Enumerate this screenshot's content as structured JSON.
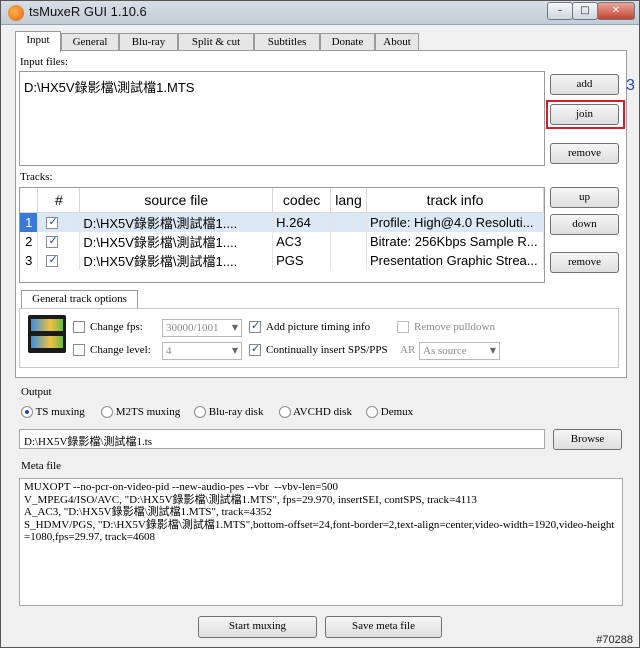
{
  "window": {
    "title": "tsMuxeR GUI 1.10.6",
    "controls": {
      "minimize": "–",
      "maximize": "□",
      "close": "✕"
    }
  },
  "tabs": [
    {
      "label": "Input",
      "active": true
    },
    {
      "label": "General"
    },
    {
      "label": "Blu-ray"
    },
    {
      "label": "Split & cut"
    },
    {
      "label": "Subtitles"
    },
    {
      "label": "Donate"
    },
    {
      "label": "About"
    }
  ],
  "input": {
    "label": "Input files:",
    "files": [
      "D:\\HX5V錄影檔\\測試檔1.MTS"
    ],
    "buttons": {
      "add": "add",
      "join": "join",
      "remove": "remove"
    }
  },
  "stray_text": "3",
  "tracks": {
    "label": "Tracks:",
    "columns": [
      "#",
      "source file",
      "codec",
      "lang",
      "track info"
    ],
    "rows": [
      {
        "num": "1",
        "source": "D:\\HX5V錄影檔\\測試檔1....",
        "codec": "H.264",
        "lang": "",
        "info": "Profile: High@4.0  Resoluti..."
      },
      {
        "num": "2",
        "source": "D:\\HX5V錄影檔\\測試檔1....",
        "codec": "AC3",
        "lang": "",
        "info": "Bitrate: 256Kbps Sample R..."
      },
      {
        "num": "3",
        "source": "D:\\HX5V錄影檔\\測試檔1....",
        "codec": "PGS",
        "lang": "",
        "info": "Presentation Graphic Strea..."
      }
    ],
    "buttons": {
      "up": "up",
      "down": "down",
      "remove": "remove"
    }
  },
  "track_options": {
    "tab_label": "General track options",
    "change_fps": "Change fps:",
    "fps_value": "30000/1001",
    "change_level": "Change level:",
    "level_value": "4",
    "add_picture_timing": "Add picture timing info",
    "insert_sps": "Continually insert SPS/PPS",
    "remove_pulldown": "Remove pulldown",
    "ar_label": "AR",
    "ar_value": "As source"
  },
  "output": {
    "title": "Output",
    "modes": [
      "TS muxing",
      "M2TS muxing",
      "Blu-ray disk",
      "AVCHD disk",
      "Demux"
    ],
    "path": "D:\\HX5V錄影檔\\測試檔1.ts",
    "browse": "Browse"
  },
  "meta": {
    "title": "Meta file",
    "lines": [
      "MUXOPT --no-pcr-on-video-pid --new-audio-pes --vbr  --vbv-len=500",
      "V_MPEG4/ISO/AVC, \"D:\\HX5V錄影檔\\測試檔1.MTS\", fps=29.970, insertSEI, contSPS, track=4113",
      "A_AC3, \"D:\\HX5V錄影檔\\測試檔1.MTS\", track=4352",
      "S_HDMV/PGS, \"D:\\HX5V錄影檔\\測試檔1.MTS\",bottom-offset=24,font-border=2,text-align=center,video-width=1920,video-height=1080,fps=29.97, track=4608"
    ]
  },
  "bottom_buttons": {
    "start": "Start muxing",
    "save": "Save meta file"
  },
  "watermark": "#70288"
}
